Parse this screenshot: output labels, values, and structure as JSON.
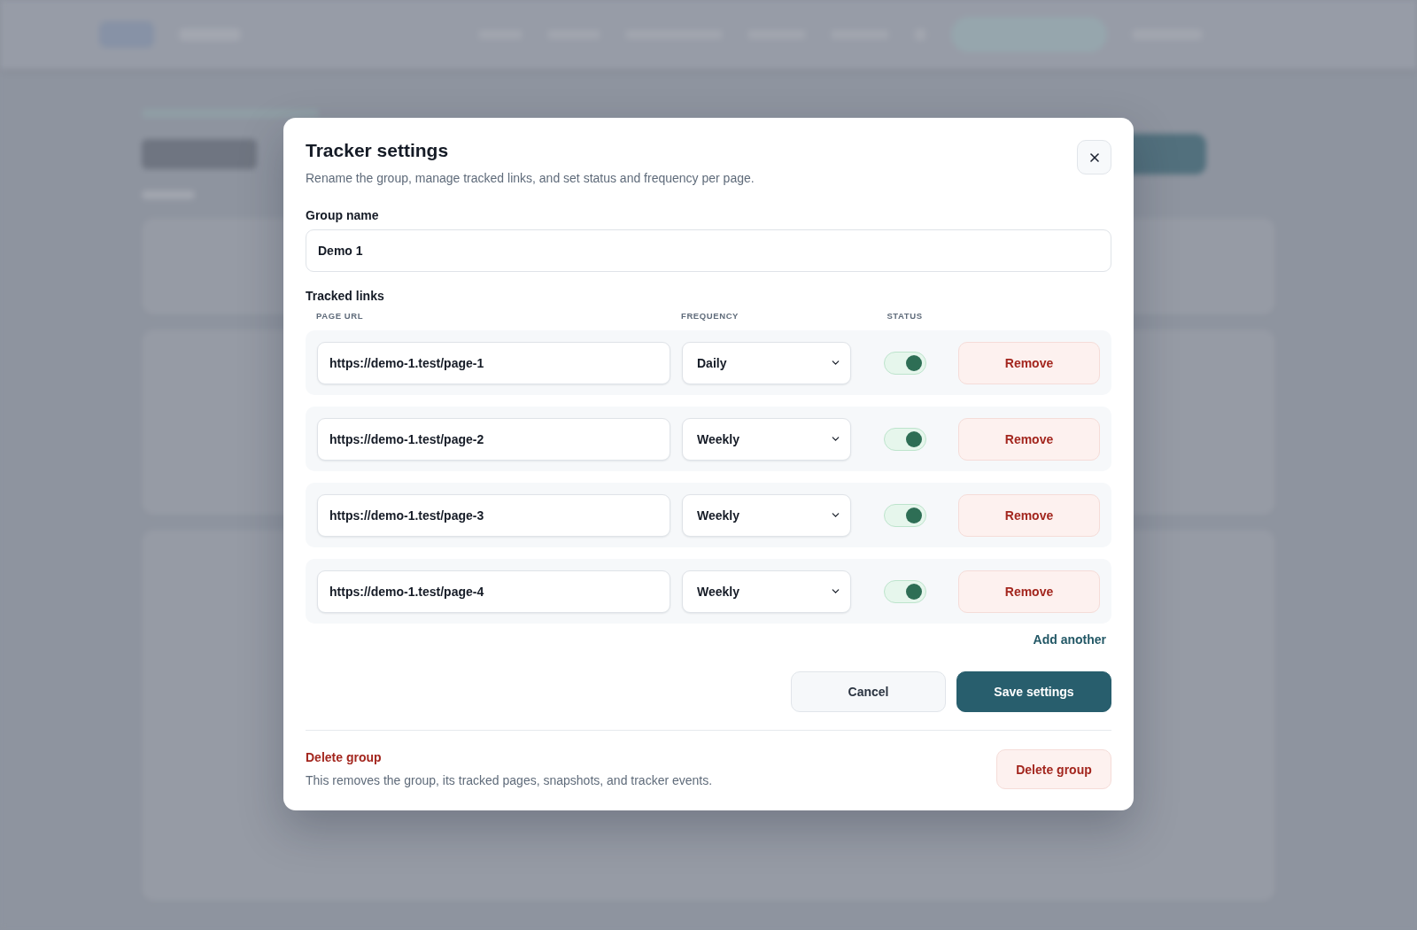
{
  "dialog": {
    "title": "Tracker settings",
    "subtitle": "Rename the group, manage tracked links, and set status and frequency per page."
  },
  "group_name": {
    "label": "Group name",
    "value": "Demo 1"
  },
  "tracked_links": {
    "label": "Tracked links",
    "columns": [
      "PAGE URL",
      "FREQUENCY",
      "STATUS"
    ],
    "rows": [
      {
        "url": "https://demo-1.test/page-1",
        "frequency": "Daily",
        "on": true,
        "remove_button": "Remove"
      },
      {
        "url": "https://demo-1.test/page-2",
        "frequency": "Weekly",
        "on": true,
        "remove_button": "Remove"
      },
      {
        "url": "https://demo-1.test/page-3",
        "frequency": "Weekly",
        "on": true,
        "remove_button": "Remove"
      },
      {
        "url": "https://demo-1.test/page-4",
        "frequency": "Weekly",
        "on": true,
        "remove_button": "Remove"
      }
    ],
    "add_button": "Add another"
  },
  "actions": [
    {
      "label": "Cancel",
      "kind": "secondary"
    },
    {
      "label": "Save settings",
      "kind": "primary"
    }
  ],
  "danger_zone": {
    "title": "Delete group",
    "description": "This removes the group, its tracked pages, snapshots, and tracker events.",
    "button": "Delete group"
  }
}
